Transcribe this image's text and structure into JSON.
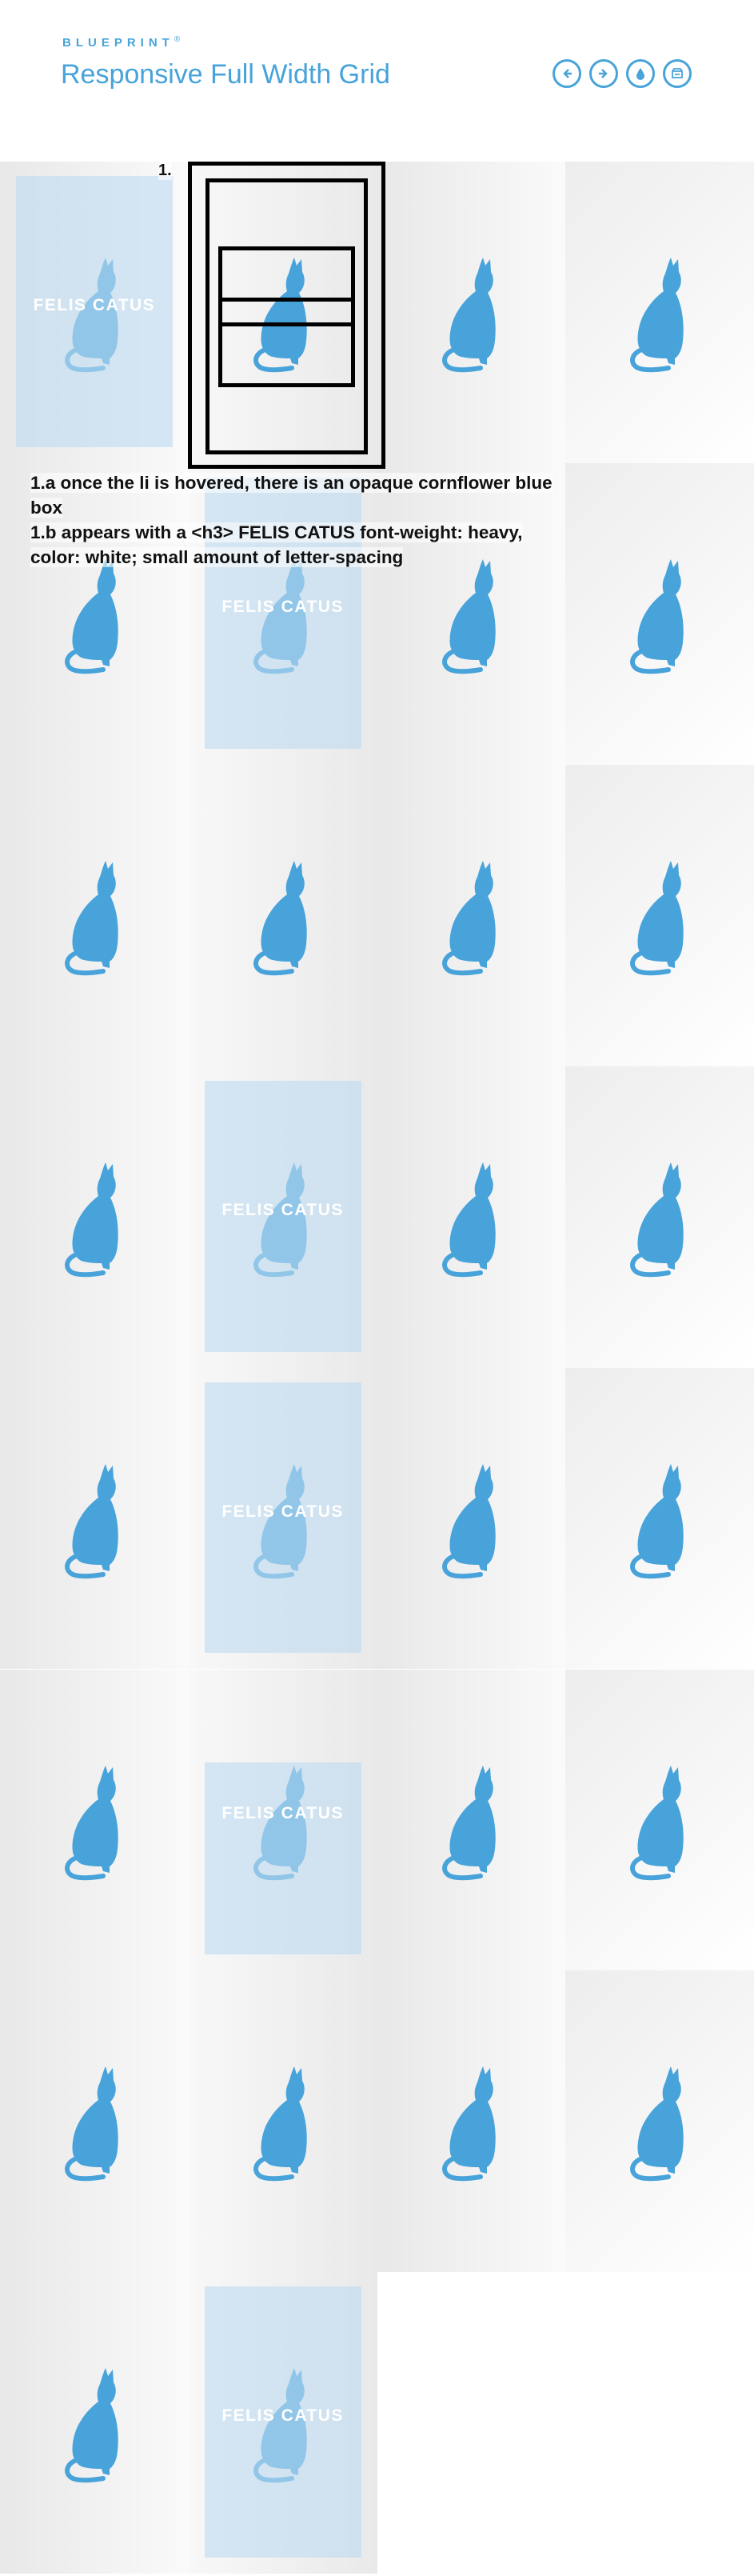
{
  "header": {
    "brand": "BLUEPRINT",
    "brand_mark": "®",
    "title": "Responsive Full Width Grid",
    "nav": [
      {
        "name": "previous-button",
        "icon": "arrow-left-icon"
      },
      {
        "name": "next-button",
        "icon": "arrow-right-icon"
      },
      {
        "name": "drop-button",
        "icon": "drop-icon"
      },
      {
        "name": "archive-button",
        "icon": "archive-icon"
      }
    ]
  },
  "grid": {
    "overlay_text": "FELIS CATUS",
    "accent_color": "#47a3da",
    "tiles": [
      {
        "hovered": true,
        "overlay": "full"
      },
      {
        "hovered": false
      },
      {
        "hovered": false
      },
      {
        "hovered": false
      },
      {
        "hovered": false
      },
      {
        "hovered": true,
        "overlay": "full"
      },
      {
        "hovered": false
      },
      {
        "hovered": false
      },
      {
        "hovered": false
      },
      {
        "hovered": false
      },
      {
        "hovered": false
      },
      {
        "hovered": false
      },
      {
        "hovered": false
      },
      {
        "hovered": true,
        "overlay": "full"
      },
      {
        "hovered": false
      },
      {
        "hovered": false
      },
      {
        "hovered": false
      },
      {
        "hovered": true,
        "overlay": "full"
      },
      {
        "hovered": false
      },
      {
        "hovered": false
      },
      {
        "hovered": false
      },
      {
        "hovered": true,
        "overlay": "bottom"
      },
      {
        "hovered": false
      },
      {
        "hovered": false
      },
      {
        "hovered": false
      },
      {
        "hovered": false
      },
      {
        "hovered": false
      },
      {
        "hovered": false
      },
      {
        "hovered": false
      },
      {
        "hovered": true,
        "overlay": "full"
      }
    ]
  },
  "annotations": {
    "marker": "1.",
    "line_1a": "1.a once the li is hovered, there is an opaque cornflower blue",
    "line_1a_cont": "box",
    "line_1b": "1.b appears with a <h3> FELIS CATUS font-weight: heavy,",
    "line_1b_cont": "color: white; small amount of letter-spacing"
  }
}
